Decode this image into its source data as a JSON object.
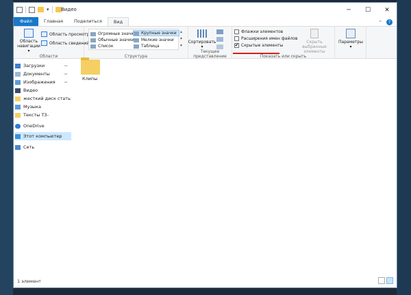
{
  "window": {
    "title": "Видео",
    "minimize": "─",
    "maximize": "☐",
    "close": "✕"
  },
  "qat": {
    "caret": "▾"
  },
  "tabs": {
    "file": "Файл",
    "home": "Главная",
    "share": "Поделиться",
    "view": "Вид",
    "collapse": "⌃",
    "help": "?"
  },
  "ribbon": {
    "panes": {
      "nav_pane": "Область навигации ▾",
      "preview_pane": "Область просмотра",
      "details_pane": "Область сведений",
      "label": "Области"
    },
    "layout": {
      "items": [
        "Огромные значки",
        "Крупные значки",
        "Обычные значки",
        "Мелкие значки",
        "Список",
        "Таблица"
      ],
      "selected": "Крупные значки",
      "label": "Структура",
      "scroll_up": "▴",
      "scroll_down": "▾",
      "expand": "▾"
    },
    "current_view": {
      "sort": "Сортировать",
      "sort_caret": "▾",
      "label": "Текущее представление"
    },
    "show_hide": {
      "item_checkboxes": "Флажки элементов",
      "file_extensions": "Расширения имен файлов",
      "hidden_items": "Скрытые элементы",
      "hide_selected": "Скрыть выбранные элементы",
      "label": "Показать или скрыть",
      "hidden_checked": true
    },
    "options": {
      "label": "Параметры",
      "caret": "▾"
    }
  },
  "nav": {
    "items": [
      {
        "label": "Загрузки",
        "pinned": true
      },
      {
        "label": "Документы",
        "pinned": true
      },
      {
        "label": "Изображения",
        "pinned": true
      },
      {
        "label": "Видео",
        "pinned": false
      },
      {
        "label": "жесткий диск стать",
        "pinned": false
      },
      {
        "label": "Музыка",
        "pinned": false
      },
      {
        "label": "Тексты ТЗ-",
        "pinned": false
      },
      {
        "label": "OneDrive",
        "pinned": false
      },
      {
        "label": "Этот компьютер",
        "pinned": false,
        "selected": true
      },
      {
        "label": "Сеть",
        "pinned": false
      }
    ],
    "pin_glyph": "📌"
  },
  "content": {
    "items": [
      {
        "name": "Клипы",
        "type": "folder"
      }
    ]
  },
  "status": {
    "count": "1 элемент"
  },
  "colors": {
    "accent": "#1979ca",
    "folder": "#f5cf63",
    "selection": "#cce8ff",
    "underline": "#d42020"
  }
}
